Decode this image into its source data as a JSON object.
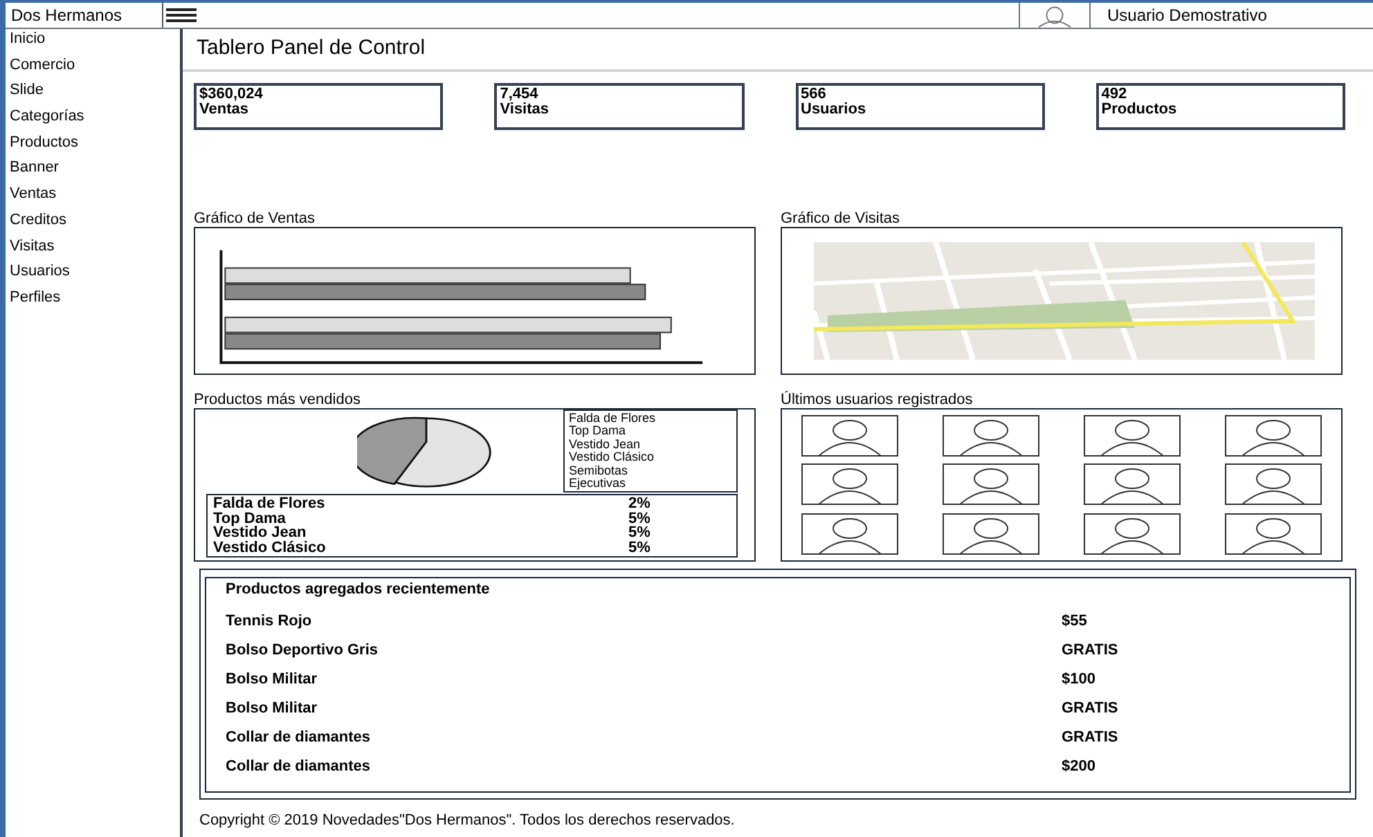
{
  "top_bar": {
    "brand": "Dos Hermanos",
    "user": "Usuario Demostrativo"
  },
  "sidebar": {
    "items": [
      {
        "label": "Inicio"
      },
      {
        "label": "Comercio"
      },
      {
        "label": "Slide"
      },
      {
        "label": "Categorías"
      },
      {
        "label": "Productos"
      },
      {
        "label": "Banner"
      },
      {
        "label": "Ventas"
      },
      {
        "label": "Creditos"
      },
      {
        "label": "Visitas"
      },
      {
        "label": "Usuarios"
      },
      {
        "label": "Perfiles"
      }
    ]
  },
  "page_title": "Tablero Panel de Control",
  "stats": [
    {
      "value": "$360,024",
      "label": "Ventas"
    },
    {
      "value": "7,454",
      "label": "Visitas"
    },
    {
      "value": "566",
      "label": "Usuarios"
    },
    {
      "value": "492",
      "label": "Productos"
    }
  ],
  "sales_chart": {
    "title": "Gráfico de Ventas"
  },
  "visits_chart": {
    "title": "Gráfico de Visitas"
  },
  "top_products": {
    "title": "Productos más vendidos",
    "legend": [
      "Falda de Flores",
      "Top Dama",
      "Vestido Jean",
      "Vestido Clásico",
      "Semibotas",
      "Ejecutivas"
    ],
    "rows": [
      {
        "name": "Falda de Flores",
        "share": "2%"
      },
      {
        "name": "Top Dama",
        "share": "5%"
      },
      {
        "name": "Vestido Jean",
        "share": "5%"
      },
      {
        "name": "Vestido Clásico",
        "share": "5%"
      }
    ]
  },
  "recent_users": {
    "title": "Últimos usuarios registrados"
  },
  "recent_products": {
    "title": "Productos agregados recientemente",
    "rows": [
      {
        "name": "Tennis Rojo",
        "price": "$55"
      },
      {
        "name": "Bolso Deportivo Gris",
        "price": "GRATIS"
      },
      {
        "name": "Bolso Militar",
        "price": "$100"
      },
      {
        "name": "Bolso Militar",
        "price": "GRATIS"
      },
      {
        "name": "Collar de diamantes",
        "price": "GRATIS"
      },
      {
        "name": "Collar de diamantes",
        "price": "$200"
      }
    ]
  },
  "footer": "Copyright © 2019 Novedades\"Dos Hermanos\". Todos los derechos reservados."
}
